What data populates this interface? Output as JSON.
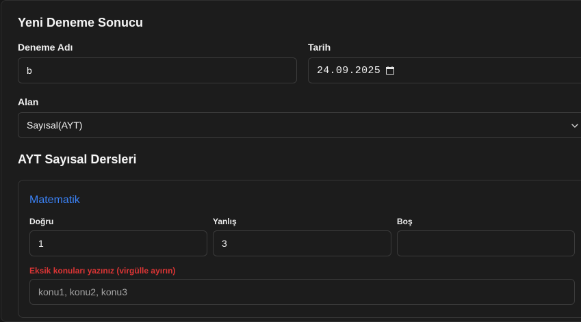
{
  "form": {
    "title": "Yeni Deneme Sonucu",
    "exam_name": {
      "label": "Deneme Adı",
      "value": "b"
    },
    "date": {
      "label": "Tarih",
      "value": "24.09.2025"
    },
    "field": {
      "label": "Alan",
      "value": "Sayısal(AYT)"
    }
  },
  "section": {
    "title": "AYT Sayısal Dersleri",
    "subject": {
      "name": "Matematik",
      "correct": {
        "label": "Doğru",
        "value": "1"
      },
      "wrong": {
        "label": "Yanlış",
        "value": "3"
      },
      "blank": {
        "label": "Boş",
        "value": ""
      },
      "missing_topics": {
        "label": "Eksik konuları yazınız (virgülle ayırın)",
        "placeholder": "konu1, konu2, konu3"
      }
    }
  },
  "colors": {
    "accent": "#3b82f6",
    "warning": "#dc3535",
    "background": "#1c1c1c"
  },
  "icons": {
    "date_picker": "calendar-icon",
    "select_arrow": "chevron-down-icon"
  }
}
